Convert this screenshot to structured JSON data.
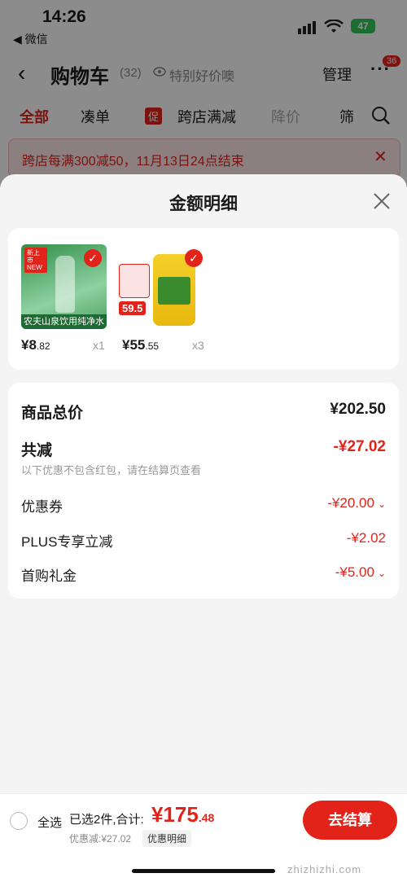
{
  "status": {
    "time": "14:26",
    "back_app": "◀ 微信",
    "battery": "47"
  },
  "nav": {
    "title": "购物车",
    "count": "(32)",
    "promo": "特别好价噢",
    "manage": "管理",
    "more": "···",
    "badge": "36"
  },
  "tabs": {
    "all": "全部",
    "cou": "凑单",
    "cross_tag": "促",
    "cross": "跨店满减",
    "drop": "降价",
    "filter": "筛"
  },
  "banner": {
    "text": "跨店每满300减50，11月13日24点结束"
  },
  "sheet": {
    "title": "金额明细",
    "items": [
      {
        "price_int": "¥8",
        "price_dec": ".82",
        "qty": "x1",
        "caption": "农夫山泉饮用纯净水",
        "tag": "新上市 NEW"
      },
      {
        "price_int": "¥55",
        "price_dec": ".55",
        "qty": "x3",
        "badge": "59.5"
      }
    ],
    "summary": {
      "total_label": "商品总价",
      "total_value": "¥202.50",
      "discount_label": "共减",
      "discount_value": "-¥27.02",
      "note": "以下优惠不包含红包，请在结算页查看",
      "coupon_label": "优惠券",
      "coupon_value": "-¥20.00",
      "plus_label": "PLUS专享立减",
      "plus_value": "-¥2.02",
      "first_label": "首购礼金",
      "first_value": "-¥5.00"
    }
  },
  "bottom": {
    "select_all": "全选",
    "selected": "已选2件,合计:",
    "total_int": "¥175",
    "total_dec": ".48",
    "discount": "优惠减:¥27.02",
    "detail": "优惠明细",
    "checkout": "去结算"
  },
  "watermark": "zhizhizhi.com",
  "colors": {
    "accent": "#e2231a"
  }
}
